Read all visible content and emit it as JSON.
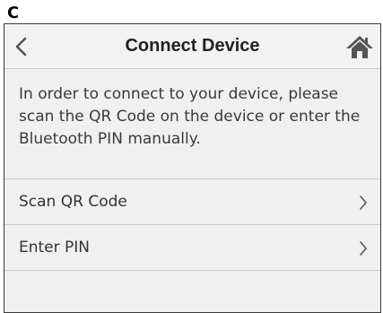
{
  "panel_letter": "C",
  "header": {
    "title": "Connect Device",
    "back_icon": "chevron-left-icon",
    "home_icon": "home-icon"
  },
  "intro": {
    "text": "In order to connect to your device, please scan the QR Code on the device or enter the Bluetooth PIN manually."
  },
  "menu": {
    "items": [
      {
        "label": "Scan QR Code",
        "icon": "chevron-right-icon"
      },
      {
        "label": "Enter PIN",
        "icon": "chevron-right-icon"
      }
    ]
  },
  "colors": {
    "background": "#f0f0f0",
    "text": "#333333",
    "divider": "#c9c9c9",
    "icon": "#555555"
  }
}
